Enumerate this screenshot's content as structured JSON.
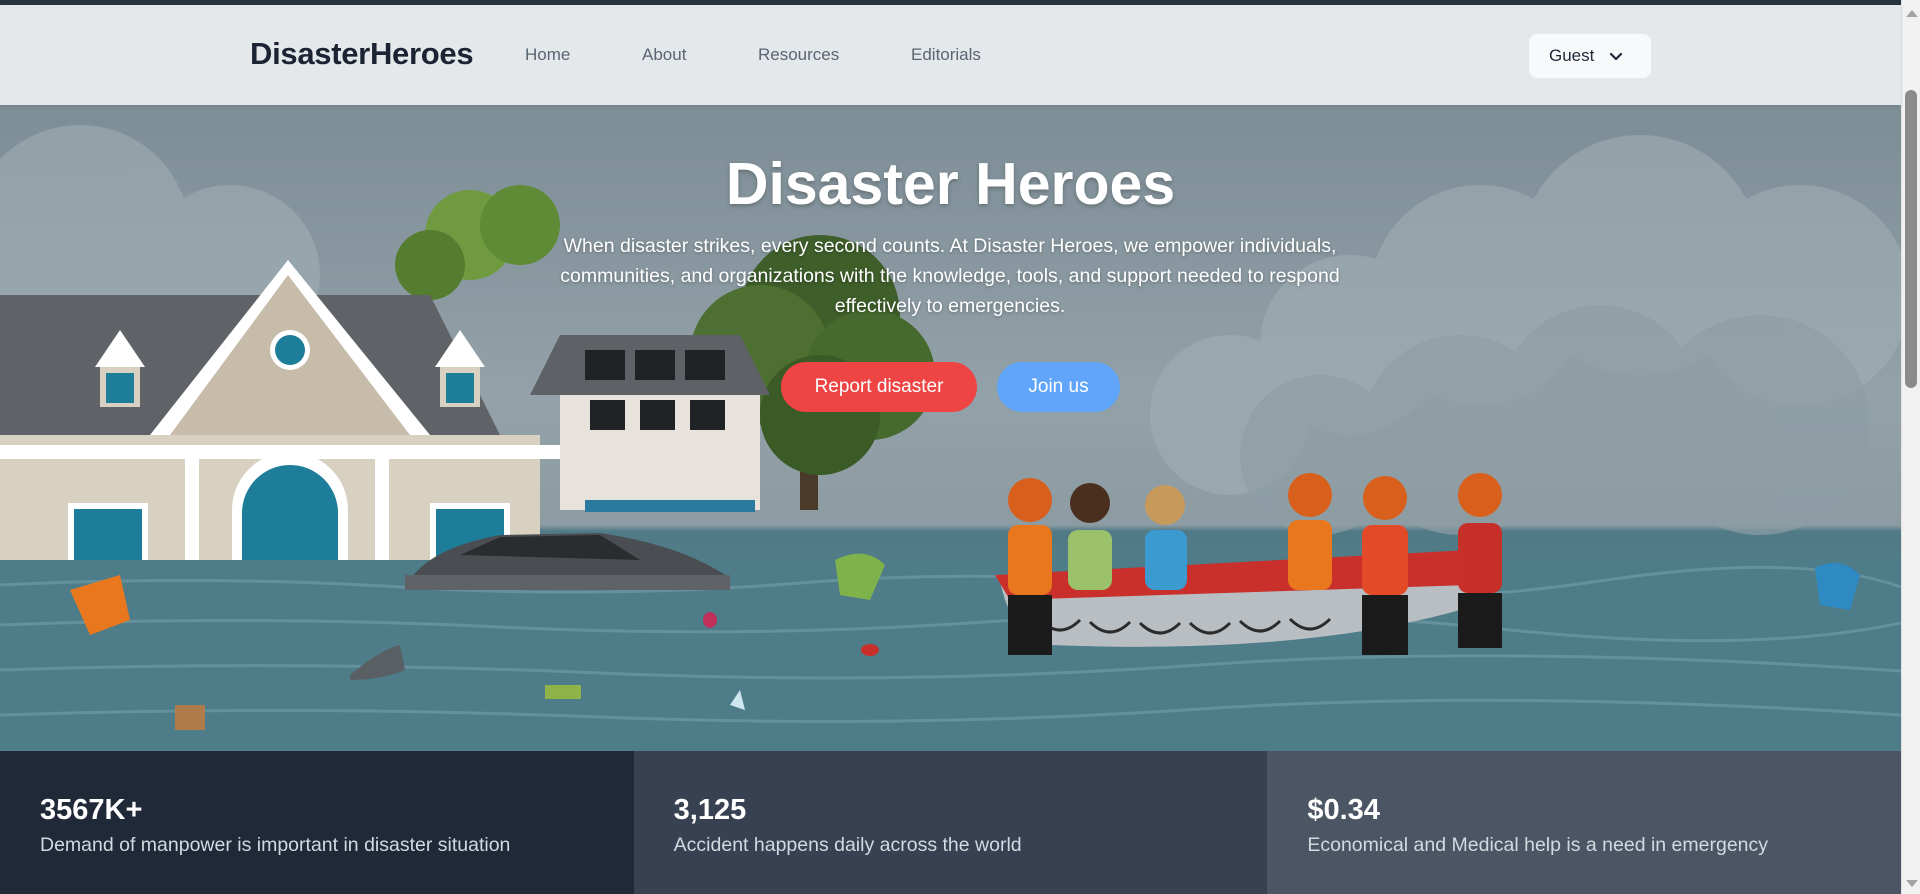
{
  "nav": {
    "brand": "DisasterHeroes",
    "links": [
      "Home",
      "About",
      "Resources",
      "Editorials"
    ],
    "user_menu": "Guest"
  },
  "hero": {
    "title": "Disaster Heroes",
    "description": "When disaster strikes, every second counts. At Disaster Heroes, we empower individuals, communities, and organizations with the knowledge, tools, and support needed to respond effectively to emergencies.",
    "report_button": "Report disaster",
    "join_button": "Join us"
  },
  "stats": [
    {
      "value": "3567K+",
      "label": "Demand of manpower is important in disaster situation",
      "background": "#1f2937"
    },
    {
      "value": "3,125",
      "label": "Accident happens daily across the world",
      "background": "#374151"
    },
    {
      "value": "$0.34",
      "label": "Economical and Medical help is a need in emergency",
      "background": "#4b5563"
    }
  ],
  "colors": {
    "report_button": "#ef4444",
    "join_button": "#60a5fa",
    "navbar": "#e4e8eb"
  }
}
